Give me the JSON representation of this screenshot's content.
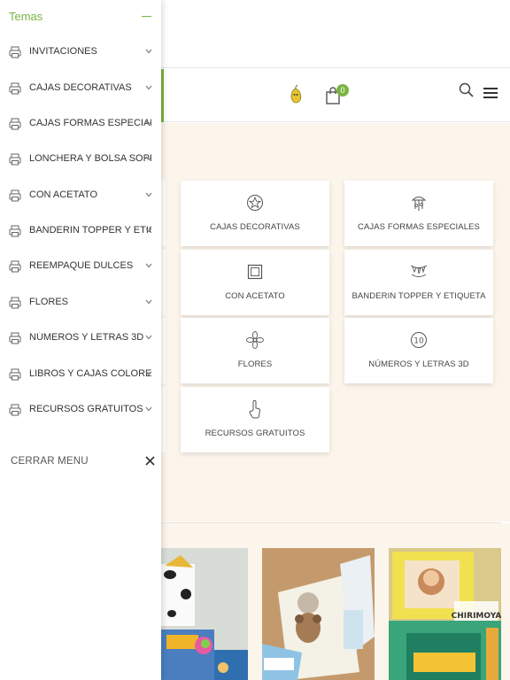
{
  "menu": {
    "title": "Temas",
    "items": [
      {
        "label": "INVITACIONES"
      },
      {
        "label": "CAJAS DECORATIVAS"
      },
      {
        "label": "CAJAS FORMAS ESPECIALES"
      },
      {
        "label": "LONCHERA Y BOLSA SOPRESA"
      },
      {
        "label": "CON ACETATO"
      },
      {
        "label": "BANDERIN TOPPER Y ETIQUETA"
      },
      {
        "label": "REEMPAQUE DULCES"
      },
      {
        "label": "FLORES"
      },
      {
        "label": "NÚMEROS Y LETRAS 3D"
      },
      {
        "label": "LIBROS Y CAJAS COLOREAR"
      },
      {
        "label": "RECURSOS GRATUITOS"
      }
    ],
    "close_label": "CERRAR MENU"
  },
  "header": {
    "cart_count": "0"
  },
  "categories": [
    {
      "label": "CAJAS DECORATIVAS",
      "icon": "star-box-icon"
    },
    {
      "label": "CAJAS FORMAS ESPECIALES",
      "icon": "carousel-icon"
    },
    {
      "label": "CON ACETATO",
      "icon": "frame-icon"
    },
    {
      "label": "BANDERIN TOPPER Y ETIQUETA",
      "icon": "bunting-icon"
    },
    {
      "label": "FLORES",
      "icon": "flower-icon"
    },
    {
      "label": "NÚMEROS Y LETRAS 3D",
      "icon": "number-ten-icon"
    },
    {
      "label": "RECURSOS GRATUITOS",
      "icon": "hand-pointer-icon"
    }
  ],
  "colors": {
    "accent": "#7cb342",
    "content_bg": "#fcf5ec"
  },
  "products": {
    "watermark": "CHIRIMOYA"
  }
}
